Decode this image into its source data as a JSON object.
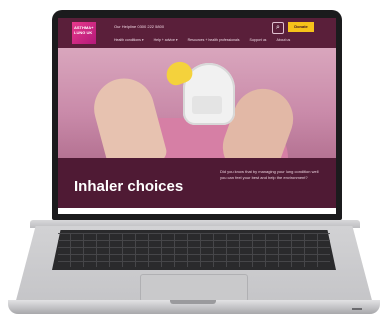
{
  "header": {
    "logo_text": "ASTHMA+ LUNG UK",
    "helpline": "Our Helpline 0300 222 5800",
    "search_icon": "search-icon",
    "donate_label": "Donate"
  },
  "nav": {
    "items": [
      "Health conditions ▾",
      "Help + advice ▾",
      "Resources + health professionals",
      "Support us",
      "About us"
    ]
  },
  "hero": {
    "title": "Inhaler choices",
    "intro": "Did you know that by managing your lung condition well you can feel your best and help the environment?"
  },
  "colors": {
    "brand": "#4f1a34",
    "accent": "#f6c21a",
    "logo": "#e8398b"
  }
}
